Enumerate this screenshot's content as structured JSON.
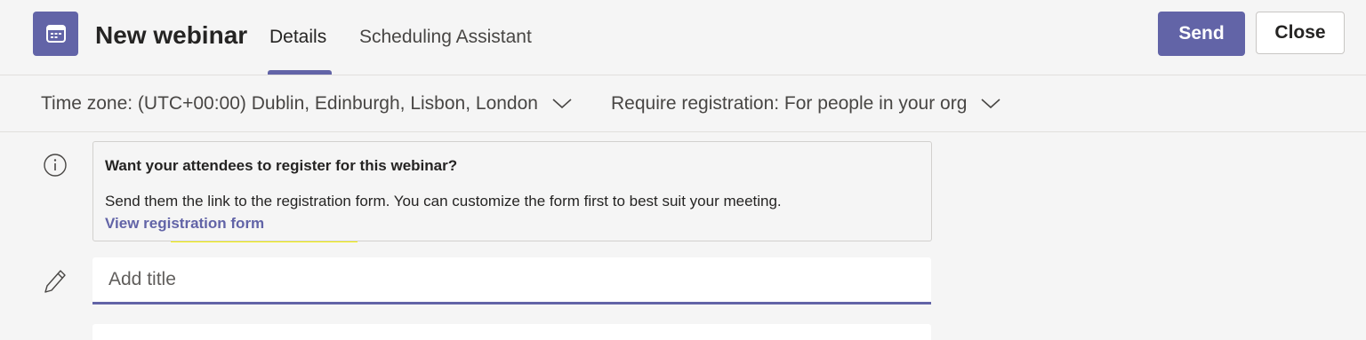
{
  "header": {
    "app_icon": "calendar-icon",
    "title": "New webinar",
    "tabs": [
      {
        "label": "Details",
        "selected": true
      },
      {
        "label": "Scheduling Assistant",
        "selected": false
      }
    ],
    "send_label": "Send",
    "close_label": "Close"
  },
  "options": {
    "timezone": "Time zone: (UTC+00:00) Dublin, Edinburgh, Lisbon, London",
    "registration": "Require registration: For people in your org"
  },
  "info": {
    "icon": "info-icon",
    "heading": "Want your attendees to register for this webinar?",
    "body": "Send them the link to the registration form. You can customize the form first to best suit your meeting.",
    "link": "View registration form"
  },
  "title_field": {
    "icon": "pencil-icon",
    "placeholder": "Add title",
    "value": ""
  },
  "colors": {
    "accent": "#6264a7",
    "highlight": "#f4f000",
    "background": "#f5f5f5"
  }
}
